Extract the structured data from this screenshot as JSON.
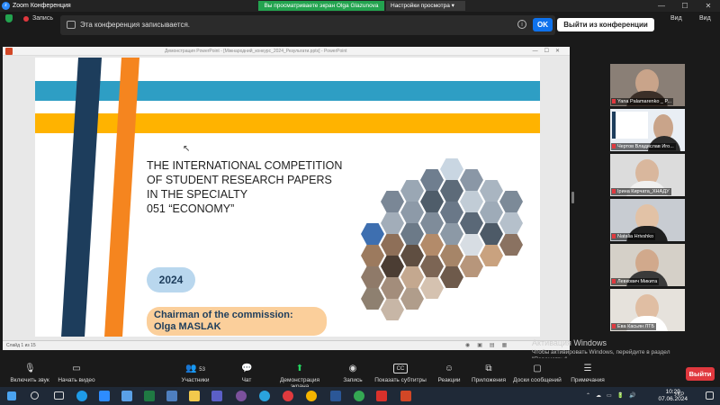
{
  "window": {
    "title": "Zoom Конференция"
  },
  "share_banner": {
    "text": "Вы просматриваете экран Olga Glazunova",
    "settings": "Настройки просмотра"
  },
  "recording": {
    "label": "Запись",
    "message": "Эта конференция записывается.",
    "ok": "OK",
    "leave": "Выйти из конференции",
    "view": "Вид",
    "view2": "Вид"
  },
  "ppt": {
    "window_title": "Демонстрация PowerPoint - [Міжнародний_конкурс_2024_Результати.pptx] - PowerPoint",
    "status": "Слайд 1 из 15",
    "slide": {
      "title_lines": [
        "THE INTERNATIONAL COMPETITION",
        "OF STUDENT RESEARCH PAPERS",
        "IN THE SPECIALTY",
        "051 “ECONOMY”"
      ],
      "year": "2024",
      "chair_line1": "Chairman of the commission:",
      "chair_line2": "Olga MASLAK"
    }
  },
  "activation": {
    "title": "Активация Windows",
    "text": "Чтобы активировать Windows, перейдите в раздел \"Параметры\"."
  },
  "participants": [
    {
      "name": "Yana Palamarenko _ P..."
    },
    {
      "name": "Чертов Владислав Иго..."
    },
    {
      "name": "Ірина Кирчата_ХНАДУ"
    },
    {
      "name": "Natalia Hrivshko"
    },
    {
      "name": "Левкович Микита"
    },
    {
      "name": "Ева Касьян ЛТБ"
    }
  ],
  "toolbar": {
    "audio": "Включить звук",
    "video": "Начать видео",
    "participants": "Участники",
    "participants_count": "53",
    "chat": "Чат",
    "share": "Демонстрация экрана",
    "record": "Запись",
    "subtitles": "Показать субтитры",
    "reactions": "Реакции",
    "apps": "Приложения",
    "whiteboard": "Доски сообщений",
    "notes": "Примечания",
    "exit": "Выйти",
    "cc": "CC"
  },
  "taskbar": {
    "time": "10:29",
    "date": "07.06.2024",
    "lang": "УКР"
  },
  "colors": {
    "zoom_blue": "#0e72ed",
    "share_green": "#23a34f",
    "slide_blue": "#2e9ec4",
    "slide_yellow": "#ffb300",
    "slide_navy": "#1d3d5c",
    "slide_orange": "#f5851f",
    "exit_red": "#e0383e"
  }
}
